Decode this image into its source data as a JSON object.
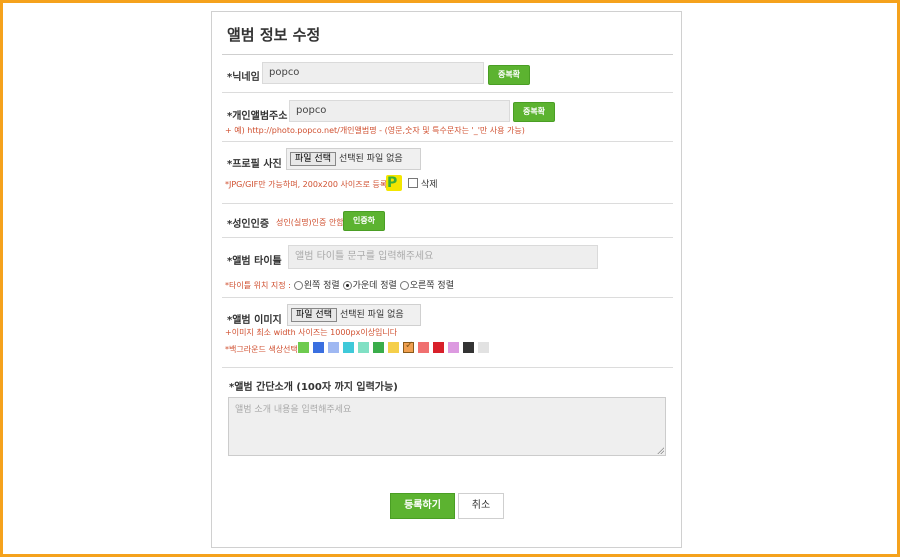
{
  "title": "앨범 정보 수정",
  "nickname": {
    "label": "닉네임",
    "value": "popco",
    "button": "중복확인"
  },
  "album_address": {
    "label": "개인앨범주소",
    "value": "popco",
    "button": "중복확인",
    "hint": "+ 예) http://photo.popco.net/개인앨범명 - (영문,숫자 및 특수문자는 '_'만 사용 가능)"
  },
  "profile_photo": {
    "label": "프로필 사진",
    "file_button": "파일 선택",
    "file_status": "선택된 파일 없음",
    "hint": "*JPG/GIF만 가능하며, 200x200 사이즈로 등록",
    "icon_letter": "P",
    "delete_label": "삭제"
  },
  "adult_verify": {
    "label": "성인인증",
    "status": "성인(실명)인증 안함",
    "button": "인증하기"
  },
  "album_title": {
    "label": "앨범 타이틀",
    "placeholder": "앨범 타이틀 문구를 입력해주세요",
    "align_prefix": "*타이틀 위치 지정 :",
    "align_options": [
      "왼쪽 정렬",
      "가운데 정렬",
      "오른쪽 정렬"
    ],
    "align_selected": 1
  },
  "album_image": {
    "label": "앨범 이미지",
    "file_button": "파일 선택",
    "file_status": "선택된 파일 없음",
    "hint": "+이미지 최소 width 사이즈는 1000px이상입니다",
    "bg_label": "*백그라운드 색상선택",
    "colors": [
      "#6ecb4f",
      "#3a6fe0",
      "#9fb8f2",
      "#3fc9d9",
      "#80e0c4",
      "#3aad4a",
      "#f5cf4a",
      "#f0a050",
      "#f07070",
      "#d8202a",
      "#dc9ae0",
      "#333333",
      "#e2e2e2"
    ],
    "selected_color": 7
  },
  "intro": {
    "label": "앨범 간단소개 (100자 까지 입력가능)",
    "placeholder": "앨범 소개 내용을 입력해주세요"
  },
  "actions": {
    "submit": "등록하기",
    "cancel": "취소"
  },
  "colors": {
    "accent": "#5cb330",
    "border": "#f5a21c",
    "hint": "#d05030"
  }
}
